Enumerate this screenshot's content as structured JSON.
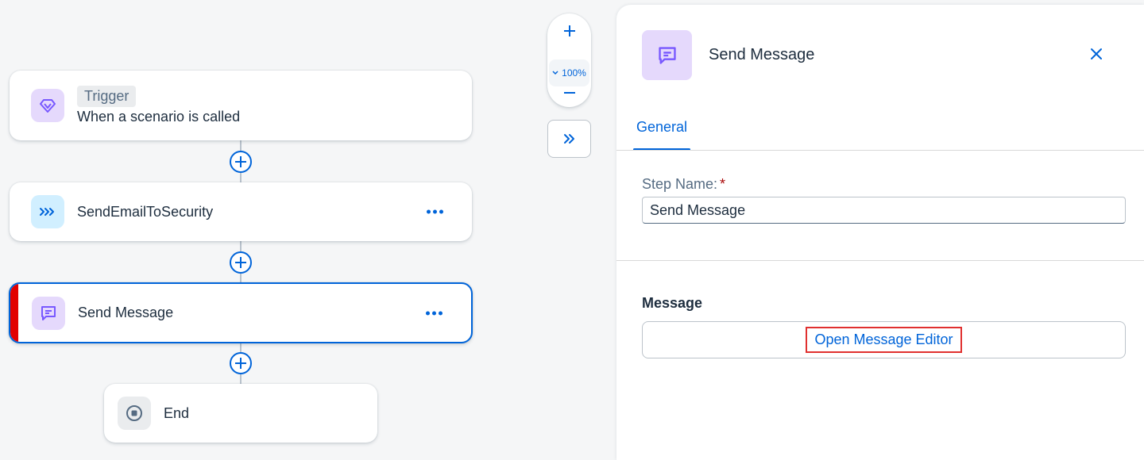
{
  "flow": {
    "trigger": {
      "badge": "Trigger",
      "text": "When a scenario is called",
      "icon": "diamond-flow-icon"
    },
    "steps": [
      {
        "label": "SendEmailToSecurity",
        "icon": "chevrons-flow-icon"
      },
      {
        "label": "Send Message",
        "icon": "message-icon",
        "selected": true
      },
      {
        "label": "End",
        "icon": "stop-icon"
      }
    ]
  },
  "zoom": {
    "level": "100%"
  },
  "panel": {
    "title": "Send Message",
    "tabs": [
      {
        "label": "General",
        "active": true
      }
    ],
    "step_name_label": "Step Name:",
    "required_mark": "*",
    "step_name_value": "Send Message",
    "message_label": "Message",
    "open_editor_label": "Open Message Editor"
  },
  "colors": {
    "accent": "#0064d9",
    "trigger_icon_bg": "#e5d9fc",
    "flow_icon_bg": "#d1efff",
    "selected_bar": "#e20000",
    "highlight_border": "#e0302f"
  }
}
